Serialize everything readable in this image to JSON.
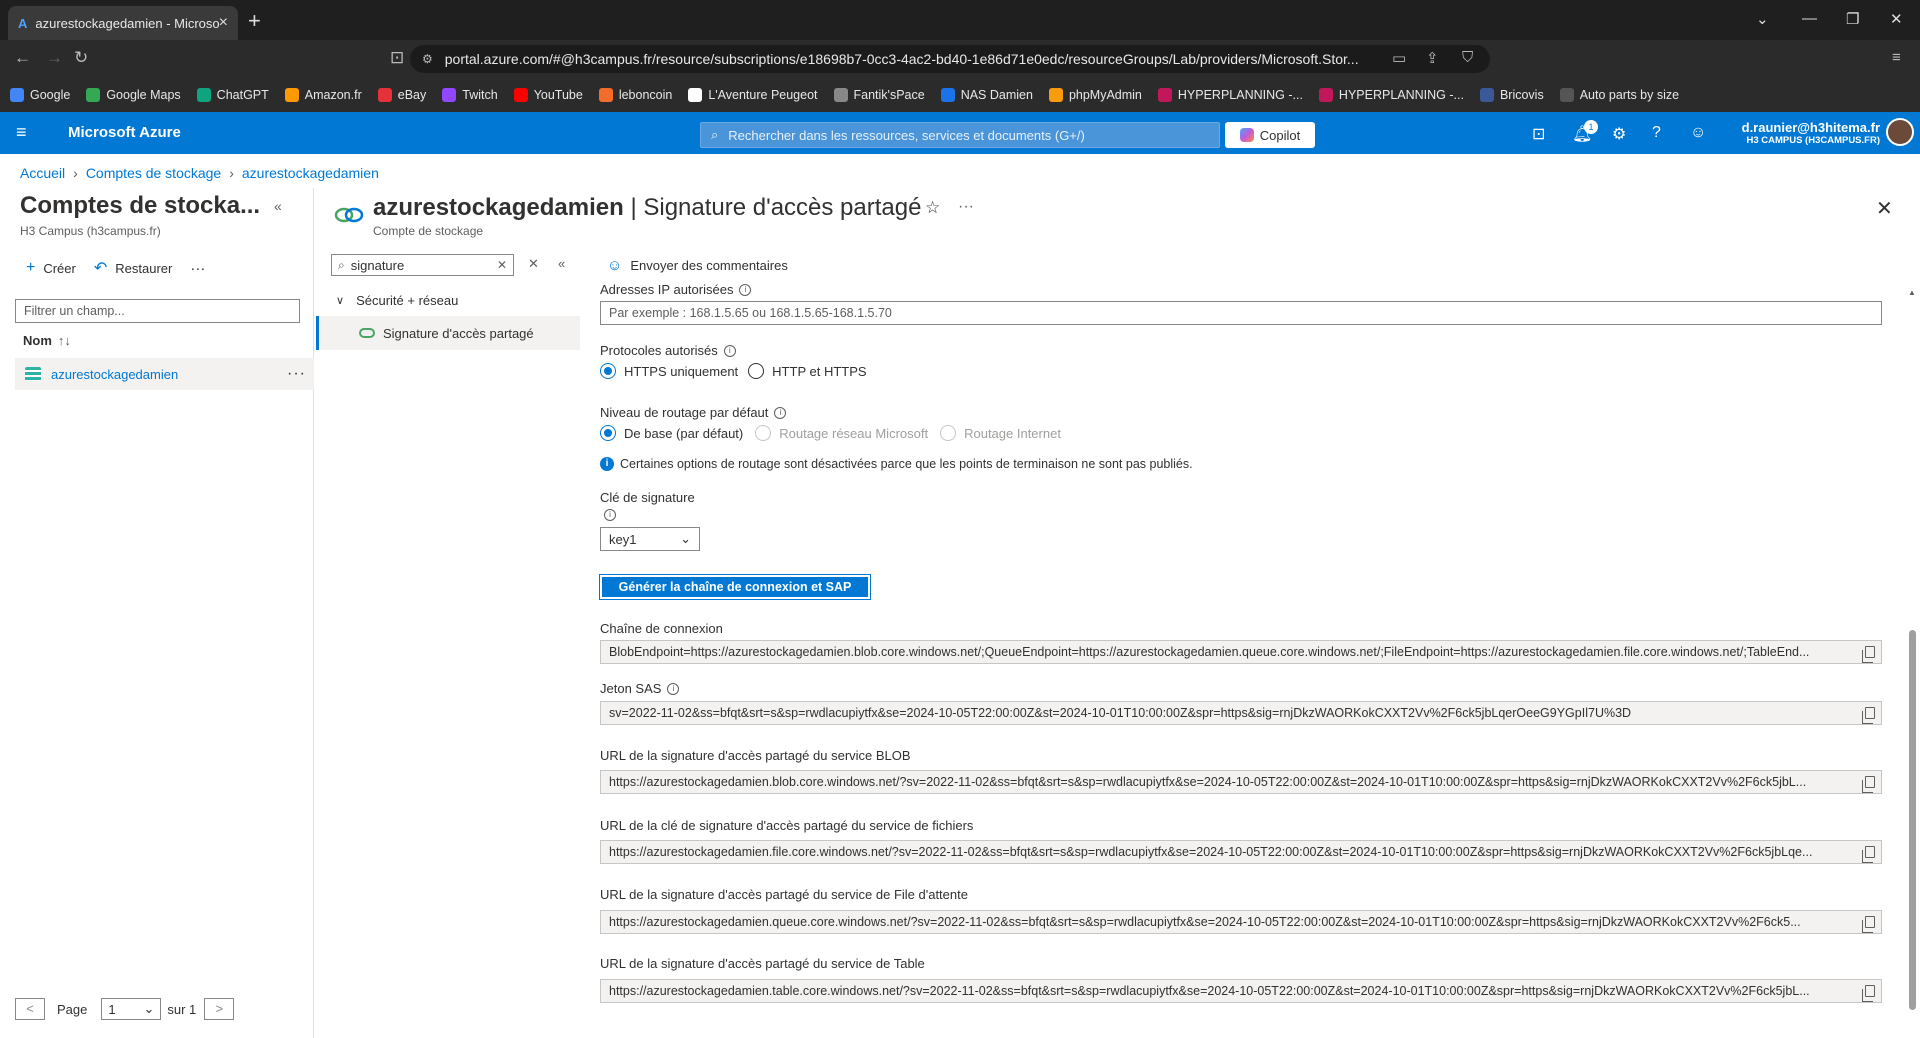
{
  "browser": {
    "tab_title": "azurestockagedamien - Microsoft Azure",
    "url": "portal.azure.com/#@h3campus.fr/resource/subscriptions/e18698b7-0cc3-4ac2-bd40-1e86d71e0edc/resourceGroups/Lab/providers/Microsoft.Stor...",
    "bookmarks": [
      "Google",
      "Google Maps",
      "ChatGPT",
      "Amazon.fr",
      "eBay",
      "Twitch",
      "YouTube",
      "leboncoin",
      "L'Aventure Peugeot",
      "Fantik'sPace",
      "NAS Damien",
      "phpMyAdmin",
      "HYPERPLANNING -...",
      "HYPERPLANNING -...",
      "Bricovis",
      "Auto parts by size"
    ],
    "bookmark_colors": [
      "#4285f4",
      "#34a853",
      "#10a37f",
      "#ff9900",
      "#e53238",
      "#9146ff",
      "#ff0000",
      "#f56b2a",
      "#ffffff",
      "#888888",
      "#1a73e8",
      "#f89c0e",
      "#c2185b",
      "#c2185b",
      "#3b5998",
      "#555555"
    ]
  },
  "azure": {
    "brand": "Microsoft Azure",
    "search_placeholder": "Rechercher dans les ressources, services et documents (G+/)",
    "copilot": "Copilot",
    "notification_count": "1",
    "account_email": "d.raunier@h3hitema.fr",
    "account_tenant": "H3 CAMPUS (H3CAMPUS.FR)"
  },
  "breadcrumb": [
    "Accueil",
    "Comptes de stockage",
    "azurestockagedamien"
  ],
  "left_pane": {
    "title": "Comptes de stocka...",
    "subtitle": "H3 Campus (h3campus.fr)",
    "create": "Créer",
    "restore": "Restaurer",
    "filter_placeholder": "Filtrer un champ...",
    "column_name": "Nom",
    "rows": [
      "azurestockagedamien"
    ],
    "pager": {
      "prev": "<",
      "page_label": "Page",
      "page": "1",
      "of": "sur 1",
      "next": ">"
    }
  },
  "resource": {
    "name": "azurestockagedamien",
    "page": "| Signature d'accès partagé",
    "type": "Compte de stockage"
  },
  "menu": {
    "search_value": "signature",
    "group": "Sécurité + réseau",
    "item": "Signature d'accès partagé"
  },
  "content": {
    "feedback": "Envoyer des commentaires",
    "ip_label": "Adresses IP autorisées",
    "ip_placeholder": "Par exemple : 168.1.5.65 ou 168.1.5.65-168.1.5.70",
    "protocols_label": "Protocoles autorisés",
    "protocols": [
      {
        "label": "HTTPS uniquement",
        "selected": true
      },
      {
        "label": "HTTP et HTTPS",
        "selected": false
      }
    ],
    "routing_label": "Niveau de routage par défaut",
    "routing": [
      {
        "label": "De base (par défaut)",
        "selected": true
      },
      {
        "label": "Routage réseau Microsoft",
        "selected": false
      },
      {
        "label": "Routage Internet",
        "selected": false
      }
    ],
    "routing_notice": "Certaines options de routage sont désactivées parce que les points de terminaison ne sont pas publiés.",
    "key_label": "Clé de signature",
    "key_value": "key1",
    "generate_button": "Générer la chaîne de connexion et SAP",
    "fields": [
      {
        "label": "Chaîne de connexion",
        "value": "BlobEndpoint=https://azurestockagedamien.blob.core.windows.net/;QueueEndpoint=https://azurestockagedamien.queue.core.windows.net/;FileEndpoint=https://azurestockagedamien.file.core.windows.net/;TableEnd..."
      },
      {
        "label": "Jeton SAS",
        "value": "sv=2022-11-02&ss=bfqt&srt=s&sp=rwdlacupiytfx&se=2024-10-05T22:00:00Z&st=2024-10-01T10:00:00Z&spr=https&sig=rnjDkzWAORKokCXXT2Vv%2F6ck5jbLqerOeeG9YGpIl7U%3D"
      },
      {
        "label": "URL de la signature d'accès partagé du service BLOB",
        "value": "https://azurestockagedamien.blob.core.windows.net/?sv=2022-11-02&ss=bfqt&srt=s&sp=rwdlacupiytfx&se=2024-10-05T22:00:00Z&st=2024-10-01T10:00:00Z&spr=https&sig=rnjDkzWAORKokCXXT2Vv%2F6ck5jbL..."
      },
      {
        "label": "URL de la clé de signature d'accès partagé du service de fichiers",
        "value": "https://azurestockagedamien.file.core.windows.net/?sv=2022-11-02&ss=bfqt&srt=s&sp=rwdlacupiytfx&se=2024-10-05T22:00:00Z&st=2024-10-01T10:00:00Z&spr=https&sig=rnjDkzWAORKokCXXT2Vv%2F6ck5jbLqe..."
      },
      {
        "label": "URL de la signature d'accès partagé du service de File d'attente",
        "value": "https://azurestockagedamien.queue.core.windows.net/?sv=2022-11-02&ss=bfqt&srt=s&sp=rwdlacupiytfx&se=2024-10-05T22:00:00Z&st=2024-10-01T10:00:00Z&spr=https&sig=rnjDkzWAORKokCXXT2Vv%2F6ck5..."
      },
      {
        "label": "URL de la signature d'accès partagé du service de Table",
        "value": "https://azurestockagedamien.table.core.windows.net/?sv=2022-11-02&ss=bfqt&srt=s&sp=rwdlacupiytfx&se=2024-10-05T22:00:00Z&st=2024-10-01T10:00:00Z&spr=https&sig=rnjDkzWAORKokCXXT2Vv%2F6ck5jbL..."
      }
    ]
  }
}
